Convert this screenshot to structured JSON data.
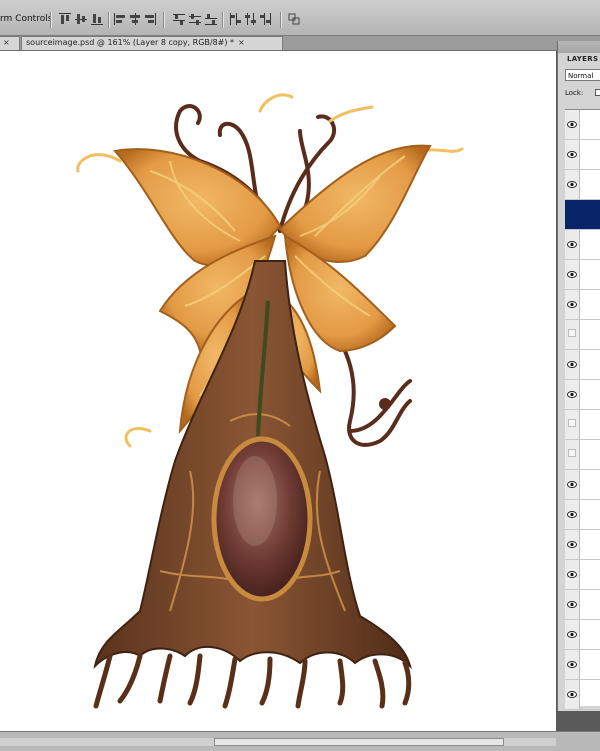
{
  "options_bar": {
    "label": "rm Controls",
    "icons": [
      "align-top-edges-icon",
      "align-vertical-centers-icon",
      "align-bottom-edges-icon",
      "align-left-edges-icon",
      "align-horizontal-centers-icon",
      "align-right-edges-icon",
      "distribute-top-icon",
      "distribute-vertical-centers-icon",
      "distribute-bottom-icon",
      "distribute-left-icon",
      "distribute-horizontal-centers-icon",
      "distribute-right-icon",
      "auto-align-layers-icon"
    ]
  },
  "tabs": [
    {
      "label": "",
      "close": "×"
    },
    {
      "label": "sourceimage.psd @ 161% (Layer 8 copy, RGB/8#) *",
      "close": "×"
    }
  ],
  "layers_panel": {
    "title": "LAYERS",
    "blend_mode": "Normal",
    "lock_label": "Lock:",
    "rows": [
      {
        "visible": true,
        "selected": false
      },
      {
        "visible": true,
        "selected": false
      },
      {
        "visible": true,
        "selected": false
      },
      {
        "visible": false,
        "selected": true
      },
      {
        "visible": true,
        "selected": false
      },
      {
        "visible": true,
        "selected": false
      },
      {
        "visible": true,
        "selected": false
      },
      {
        "visible": false,
        "selected": false
      },
      {
        "visible": true,
        "selected": false
      },
      {
        "visible": true,
        "selected": false
      },
      {
        "visible": false,
        "selected": false
      },
      {
        "visible": false,
        "selected": false
      },
      {
        "visible": true,
        "selected": false
      },
      {
        "visible": true,
        "selected": false
      },
      {
        "visible": true,
        "selected": false
      },
      {
        "visible": true,
        "selected": false
      },
      {
        "visible": true,
        "selected": false
      },
      {
        "visible": true,
        "selected": false
      },
      {
        "visible": true,
        "selected": false
      },
      {
        "visible": true,
        "selected": false
      }
    ]
  },
  "canvas": {
    "artwork": "mandrake-root-creature-illustration",
    "colors": {
      "wing": "#e9a24a",
      "wing_dark": "#b56b1d",
      "vein": "#f2c46a",
      "trunk": "#7a4a2c",
      "trunk_dark": "#4f2c18",
      "pod": "#5e2f28",
      "pod_light": "#9b6a5c",
      "tendril": "#5a2c1c"
    }
  }
}
